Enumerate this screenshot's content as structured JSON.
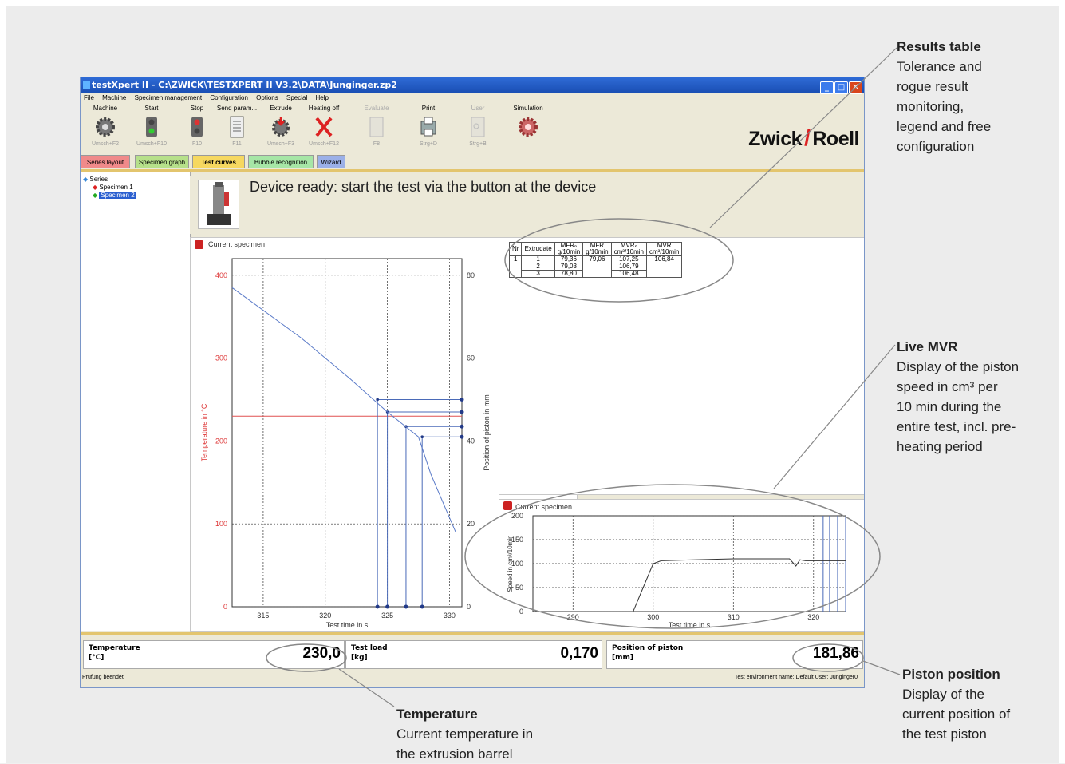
{
  "window": {
    "title": "testXpert II - C:\\ZWICK\\TESTXPERT II V3.2\\DATA\\Junginger.zp2"
  },
  "menu": [
    "File",
    "Machine",
    "Specimen management",
    "Configuration",
    "Options",
    "Special",
    "Help"
  ],
  "toolbar": [
    {
      "label": "Machine",
      "key": "Umsch+F2",
      "icon": "gear-icon",
      "enabled": true
    },
    {
      "label": "Start",
      "key": "Umsch+F10",
      "icon": "traffic-light-green-icon",
      "enabled": true
    },
    {
      "label": "Stop",
      "key": "F10",
      "icon": "traffic-light-red-icon",
      "enabled": true
    },
    {
      "label": "Send param...",
      "key": "F11",
      "icon": "document-icon",
      "enabled": true
    },
    {
      "label": "Extrude",
      "key": "Umsch+F3",
      "icon": "gear-arrow-icon",
      "enabled": true
    },
    {
      "label": "Heating off",
      "key": "Umsch+F12",
      "icon": "red-x-icon",
      "enabled": true
    },
    {
      "label": "Evaluate",
      "key": "F8",
      "icon": "evaluate-icon",
      "enabled": false
    },
    {
      "label": "Print",
      "key": "Strg+D",
      "icon": "printer-icon",
      "enabled": true
    },
    {
      "label": "User",
      "key": "Strg+B",
      "icon": "user-icon",
      "enabled": false
    },
    {
      "label": "Simulation",
      "key": "",
      "icon": "gear-red-icon",
      "enabled": true
    }
  ],
  "logo": {
    "left": "Zwick",
    "right": "Roell"
  },
  "tabs": [
    {
      "label": "Series layout",
      "color": "#f08a8a"
    },
    {
      "label": "Specimen graph",
      "color": "#b6e08a"
    },
    {
      "label": "Test curves",
      "color": "#f6d860",
      "active": true
    },
    {
      "label": "Bubble recognition",
      "color": "#a6e6a6"
    },
    {
      "label": "Wizard",
      "color": "#9bb0e8"
    }
  ],
  "tree": {
    "root": "Series",
    "items": [
      "Specimen 1",
      "Specimen 2"
    ],
    "selected": "Specimen 2"
  },
  "status_message": "Device ready: start the test via the button at the device",
  "left_chart": {
    "title": "Current specimen"
  },
  "results_table": {
    "headers": [
      {
        "l1": "Nr",
        "l2": ""
      },
      {
        "l1": "Extrudate",
        "l2": ""
      },
      {
        "l1": "MFRₙ",
        "l2": "g/10min"
      },
      {
        "l1": "MFR",
        "l2": "g/10min"
      },
      {
        "l1": "MVRₙ",
        "l2": "cm³/10min"
      },
      {
        "l1": "MVR",
        "l2": "cm³/10min"
      }
    ],
    "nr": "1",
    "mfr": "79,06",
    "mvr": "106,84",
    "rows": [
      {
        "extrudate": "1",
        "mfrn": "79,36",
        "mvrn": "107,25"
      },
      {
        "extrudate": "2",
        "mfrn": "79,03",
        "mvrn": "106,79"
      },
      {
        "extrudate": "3",
        "mfrn": "78,80",
        "mvrn": "106,48"
      }
    ]
  },
  "right_chart": {
    "title": "Current specimen"
  },
  "readouts": [
    {
      "label1": "Temperature",
      "label2": "[°C]",
      "value": "230,0"
    },
    {
      "label1": "Test load",
      "label2": "[kg]",
      "value": "0,170"
    },
    {
      "label1": "Position of piston",
      "label2": "[mm]",
      "value": "181,86"
    }
  ],
  "statusbar": {
    "left": "Prüfung beendet",
    "right": "Test environment name: Default   User: Junginger0"
  },
  "callouts": {
    "results": {
      "title": "Results table",
      "text": [
        "Tolerance and",
        "rogue result",
        "monitoring,",
        "legend and free",
        "configuration"
      ]
    },
    "mvr": {
      "title": "Live MVR",
      "text": [
        "Display of the piston",
        "speed in cm³ per",
        "10 min during the",
        "entire test, incl. pre-",
        "heating period"
      ]
    },
    "piston": {
      "title": "Piston position",
      "text": [
        "Display of the",
        "current position of",
        "the test piston"
      ]
    },
    "temperature": {
      "title": "Temperature",
      "text": [
        "Current temperature in",
        "the extrusion barrel"
      ]
    }
  },
  "chart_data": [
    {
      "type": "line",
      "title": "",
      "xlabel": "Test time in s",
      "ylabel_left": "Temperature in °C",
      "ylabel_right": "Position of piston in mm",
      "xlim": [
        312.5,
        331
      ],
      "ylim_left": [
        0,
        420
      ],
      "ylim_right": [
        0,
        84
      ],
      "x_ticks": [
        315,
        320,
        325,
        330
      ],
      "y_left_ticks": [
        0,
        100,
        200,
        300,
        400
      ],
      "y_right_ticks": [
        0,
        20,
        40,
        60,
        80
      ],
      "grid": true,
      "series": [
        {
          "name": "",
          "axis": "right",
          "color": "#5a7ac8",
          "x": [
            312.5,
            318,
            322,
            325,
            327.5,
            328.5,
            330.5
          ],
          "y": [
            77,
            65,
            55,
            47,
            41,
            32,
            18
          ]
        },
        {
          "name": "",
          "axis": "left",
          "color": "#e05050",
          "x": [
            312.5,
            331
          ],
          "y": [
            230,
            230
          ]
        }
      ],
      "markers_x": [
        324.2,
        325,
        326.5,
        327.8
      ],
      "markers_y_right": [
        50,
        47,
        43.5,
        41
      ]
    },
    {
      "type": "line",
      "title": "",
      "xlabel": "Test time in s",
      "ylabel": "Speed in cm³/10min",
      "xlim": [
        285,
        324
      ],
      "ylim": [
        0,
        200
      ],
      "x_ticks": [
        290,
        300,
        310,
        320
      ],
      "y_ticks": [
        0,
        50,
        100,
        150,
        200
      ],
      "grid": true,
      "series": [
        {
          "name": "",
          "color": "#333333",
          "x": [
            297.5,
            299,
            300,
            301,
            305,
            310,
            317,
            317.8,
            318.3,
            319,
            324
          ],
          "y": [
            0,
            60,
            100,
            106,
            108,
            110,
            110,
            95,
            108,
            106,
            106
          ]
        }
      ],
      "vertical_markers_x": [
        321.2,
        322,
        323,
        324
      ]
    }
  ]
}
